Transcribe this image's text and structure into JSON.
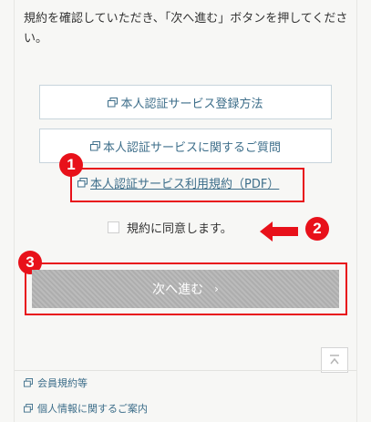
{
  "intro_text": "規約を確認していただき、「次へ進む」ボタンを押してください。",
  "links": {
    "registration_method": "本人認証サービス登録方法",
    "faq": "本人認証サービスに関するご質問",
    "terms_pdf": "本人認証サービス利用規約（PDF）"
  },
  "agreement": {
    "label": "規約に同意します。",
    "checked": false
  },
  "next_button": {
    "label": "次へ進む",
    "chevron": "›",
    "state": "disabled"
  },
  "badges": {
    "one": "1",
    "two": "2",
    "three": "3"
  },
  "footer": {
    "member_terms": "会員規約等",
    "privacy": "個人情報に関するご案内"
  },
  "icons": {
    "external_window": "external-window-icon",
    "scroll_top": "scroll-top-icon",
    "arrow": "left-arrow-icon"
  },
  "colors": {
    "annotation_red": "#e8111a",
    "link_blue": "#3d6e8a",
    "disabled_button": "#b3b3b3"
  }
}
